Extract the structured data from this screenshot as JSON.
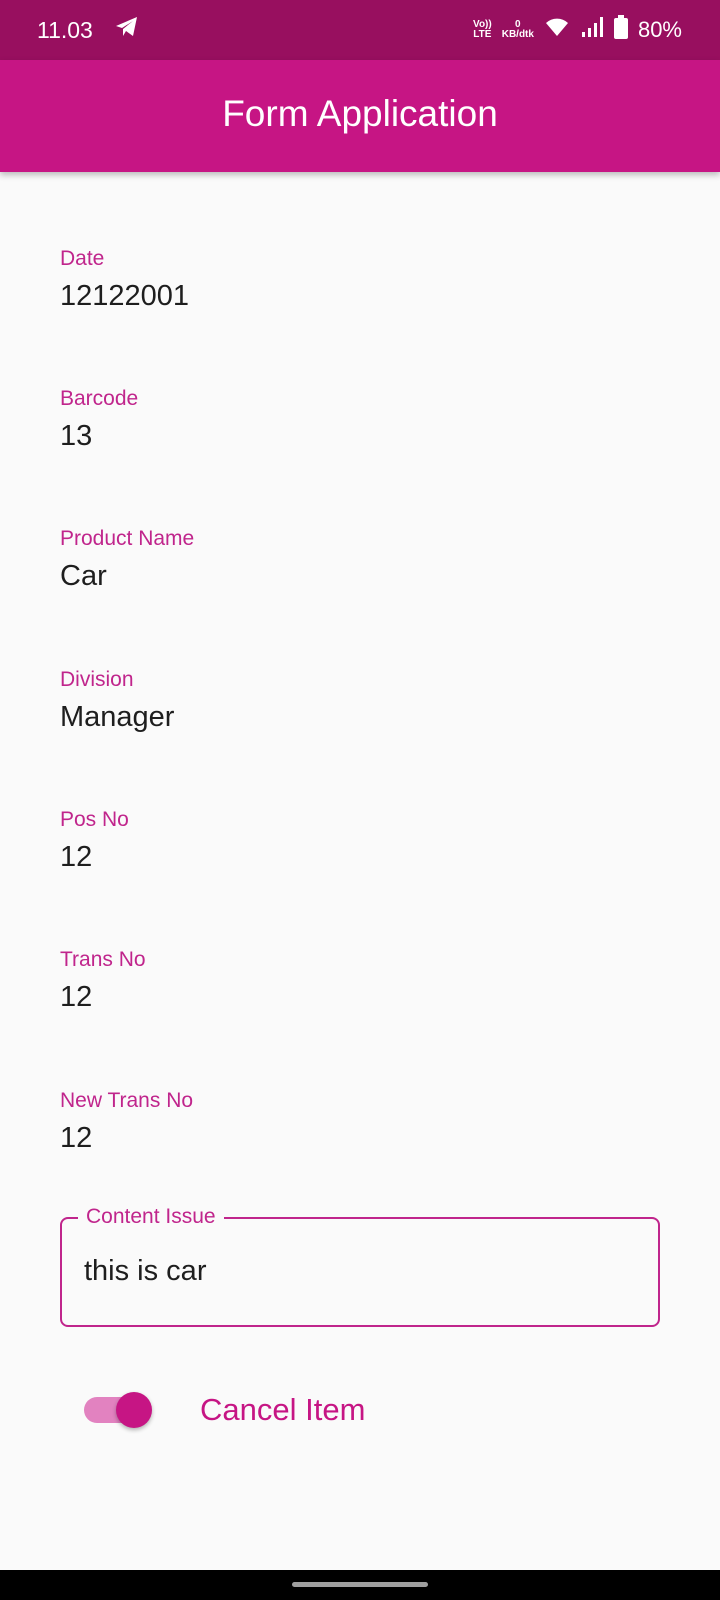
{
  "status_bar": {
    "time": "11.03",
    "volte_top": "Vo))",
    "volte_bottom": "LTE",
    "net_speed_value": "0",
    "net_speed_unit": "KB/dtk",
    "battery": "80%"
  },
  "app_bar": {
    "title": "Form Application"
  },
  "form": {
    "fields": [
      {
        "label": "Date",
        "value": "12122001"
      },
      {
        "label": "Barcode",
        "value": "13"
      },
      {
        "label": "Product Name",
        "value": "Car"
      },
      {
        "label": "Division",
        "value": "Manager"
      },
      {
        "label": "Pos No",
        "value": "12"
      },
      {
        "label": "Trans No",
        "value": "12"
      },
      {
        "label": "New Trans No",
        "value": "12"
      }
    ],
    "content_issue": {
      "label": "Content Issue",
      "value": "this is car"
    },
    "cancel_item": {
      "label": "Cancel Item",
      "checked": true
    }
  },
  "colors": {
    "status_bar": "#980f5f",
    "app_bar": "#c61584",
    "accent": "#c0258c"
  }
}
